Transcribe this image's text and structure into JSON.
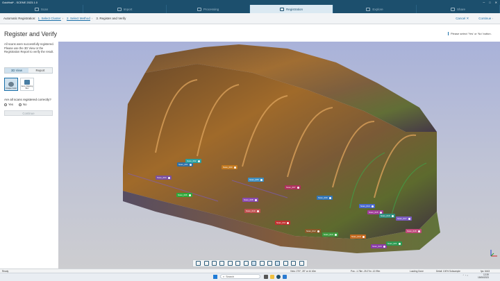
{
  "window": {
    "title": "GoldHall* - SCENE 2023.1.0",
    "controls": [
      "minimize",
      "maximize",
      "close"
    ]
  },
  "steps": [
    {
      "label": "Scan",
      "active": false
    },
    {
      "label": "Import",
      "active": false
    },
    {
      "label": "Processing",
      "active": false
    },
    {
      "label": "Registration",
      "active": true
    },
    {
      "label": "Explore",
      "active": false
    },
    {
      "label": "Share",
      "active": false
    }
  ],
  "crumbs": {
    "prefix": "Automatic Registration:",
    "items": [
      "1. Select Cluster",
      "2. Select Method",
      "3. Register and Verify"
    ],
    "cancel": "Cancel",
    "continue": "Continue"
  },
  "page": {
    "title": "Register and Verify",
    "hint": "Please select 'Yes' or 'No' button.",
    "description": "All scans were successfully registered. Please use the 3D View or the Registration Report to verify the result."
  },
  "left": {
    "tabs": [
      "3D View",
      "Report"
    ],
    "active_tab": "3D View",
    "tools": [
      {
        "label": "Unique Color",
        "icon": "palette-icon",
        "selected": true
      },
      {
        "label": "Auto Clipping Box",
        "icon": "clipping-box-icon",
        "selected": false
      }
    ],
    "question": "Are all scans registered correctly?",
    "options": [
      "Yes",
      "No"
    ],
    "continue": "Continue"
  },
  "scan_tags": [
    "Scan_001",
    "Scan_002",
    "Scan_003",
    "Scan_004",
    "Scan_005",
    "Scan_006",
    "Scan_007",
    "Scan_008",
    "Scan_009",
    "Scan_010",
    "Scan_011",
    "Scan_012",
    "Scan_013",
    "Scan_014",
    "Scan_015",
    "Scan_016",
    "Scan_017",
    "Scan_018",
    "Scan_019",
    "Scan_020",
    "Scan_021"
  ],
  "status": {
    "left": "Ready",
    "view": "View: 270°, 28° or 44 40m",
    "pos": "Pos: -1.78m -25.27m -12.99m",
    "loading": "Loading Done",
    "detail": "Detail: 100% Subsample",
    "fps": "fps: 6443"
  },
  "taskbar": {
    "search": "Search",
    "time": "12:39",
    "date": "15/06/2023"
  }
}
